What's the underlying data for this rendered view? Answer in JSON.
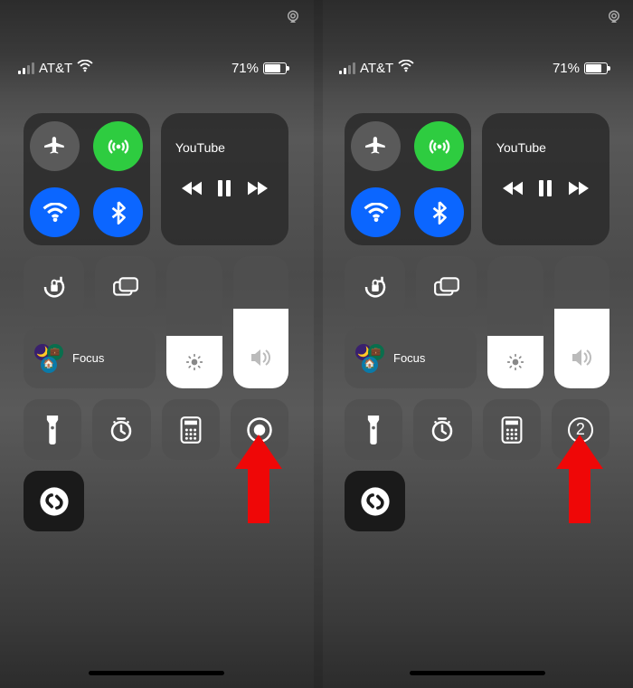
{
  "status": {
    "carrier": "AT&T",
    "battery_pct": "71%",
    "battery_fill": 71,
    "signal_bars_on": 2
  },
  "connectivity": {
    "airplane": "airplane-icon",
    "cellular": "cellular-icon",
    "wifi": "wifi-icon",
    "bluetooth": "bluetooth-icon"
  },
  "media": {
    "now_playing": "YouTube"
  },
  "focus": {
    "label": "Focus"
  },
  "tiles": {
    "orientation_lock": "orientation-lock-icon",
    "screen_mirror": "screen-mirror-icon",
    "brightness": "brightness-icon",
    "volume": "volume-icon",
    "flashlight": "flashlight-icon",
    "timer": "timer-icon",
    "calculator": "calculator-icon",
    "screen_record": "screen-record-icon",
    "screen_record_countdown": "2",
    "shazam": "shazam-icon"
  },
  "colors": {
    "green": "#2ecc40",
    "blue": "#0b66ff",
    "arrow": "#ef0707"
  }
}
